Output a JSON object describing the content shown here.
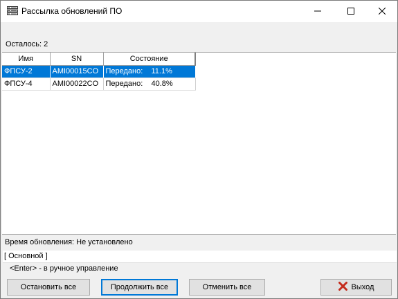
{
  "window": {
    "title": "Рассылка обновлений ПО",
    "app_icon": "server-list-icon",
    "controls": {
      "minimize": "minimize-icon",
      "maximize": "maximize-icon",
      "close": "close-icon"
    }
  },
  "remaining_text": "Осталось: 2",
  "table": {
    "columns": [
      "Имя",
      "SN",
      "Состояние"
    ],
    "rows": [
      {
        "name": "ФПСУ-2",
        "sn": "AMI00015CO",
        "state": "Передано:",
        "progress": "11.1%",
        "selected": true
      },
      {
        "name": "ФПСУ-4",
        "sn": "AMI00022CO",
        "state": "Передано:",
        "progress": "40.8%",
        "selected": false
      }
    ]
  },
  "status": {
    "update_time": "Время обновления: Не установлено",
    "mode": "[ Основной ]",
    "hint": "<Enter> - в ручное управление"
  },
  "buttons": {
    "stop_all": "Остановить все",
    "continue_all": "Продолжить все",
    "cancel_all": "Отменить все",
    "exit": "Выход",
    "exit_icon": "red-x-icon"
  },
  "colors": {
    "selection": "#0078d7",
    "exit_icon": "#c42b1c"
  }
}
